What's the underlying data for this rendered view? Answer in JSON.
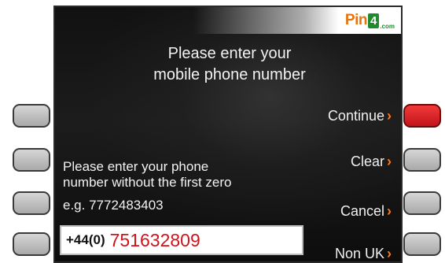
{
  "brand": {
    "name": "Pin",
    "number": "4",
    "suffix": ".com"
  },
  "heading": {
    "line1": "Please enter your",
    "line2": "mobile phone number"
  },
  "menu": {
    "continue_label": "Continue",
    "clear_label": "Clear",
    "cancel_label": "Cancel",
    "non_uk_label": "Non UK"
  },
  "instructions": {
    "line1": "Please enter your phone",
    "line2": "number without the first zero",
    "line3": "e.g. 7772483403"
  },
  "phone_input": {
    "prefix": "+44(0)",
    "value": "751632809"
  },
  "colors": {
    "accent": "#ff7a1a",
    "input_text": "#d0141a",
    "active_key": "#e32228",
    "brand_green": "#1f8a2e"
  }
}
